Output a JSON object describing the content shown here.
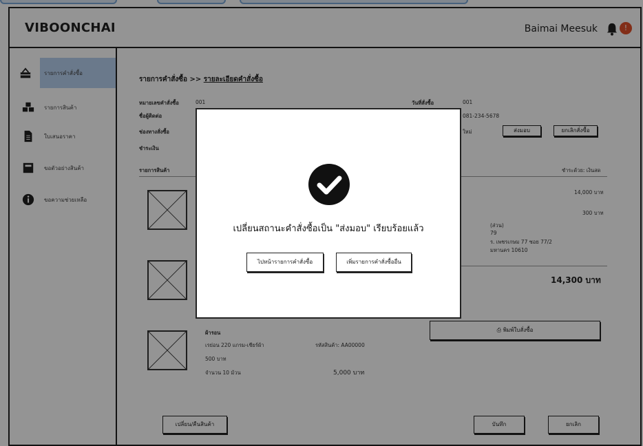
{
  "header": {
    "logo": "VIBOONCHAI",
    "user_name": "Baimai Meesuk",
    "notification_count": "!"
  },
  "sidebar": {
    "items": [
      {
        "label": "รายการคำสั่งซื้อ",
        "icon": "basket-icon",
        "active": true
      },
      {
        "label": "รายการสินค้า",
        "icon": "boxes-icon",
        "active": false
      },
      {
        "label": "ใบเสนอราคา",
        "icon": "document-icon",
        "active": false
      },
      {
        "label": "ขอตัวอย่างสินค้า",
        "icon": "sample-box-icon",
        "active": false
      },
      {
        "label": "ขอความช่วยเหลือ",
        "icon": "info-icon",
        "active": false
      }
    ]
  },
  "main": {
    "breadcrumb_root": "รายการคำสั่งซื้อ >> ",
    "breadcrumb_current": "รายละเอียดคำสั่งซื้อ",
    "order_no_label": "หมายเลขคำสั่งซื้อ",
    "order_no_value": "001",
    "customer_label": "ชื่อผู้ติดต่อ",
    "channel_label": "ช่องทางสั่งซื้อ",
    "payment_label": "ชำระเงิน",
    "order_date_label": "วันที่สั่งซื้อ",
    "order_date_value": "001",
    "phone_value": "081-234-5678",
    "status_suffix": "ใหม่",
    "deliver_button": "ส่งมอบ",
    "cancel_order_button": "ยกเลิกสั่งซื้อ",
    "items_header": "รายการสินค้า",
    "right_header": "ชำระด้วย: เงินสด",
    "amount_1": "14,000 บาท",
    "amount_2": "300 บาท",
    "addr_1": "(ส่วน)",
    "addr_2": "79",
    "addr_3": "ร. เพชรเกษม 77 ซอย 77/2",
    "addr_4": "มหานคร 10610",
    "grand_total": "14,300 บาท",
    "print_button": "พิมพ์ใบสั่งซื้อ",
    "item3_name": "ผ้ารอน",
    "item3_spec": "เรย่อน 220 แกรม-เชียร์ผ้า",
    "item3_code": "รหัสสินค้า: AA00000",
    "item3_price": "500 บาท",
    "item3_qty": "จำนวน 10 ม้วน",
    "item3_total": "5,000 บาท",
    "exchange_button": "เปลี่ยน/คืนสินค้า",
    "save_button": "บันทึก",
    "cancel_button": "ยกเลิก"
  },
  "modal": {
    "message": "เปลี่ยนสถานะคำสั่งซื้อเป็น \"ส่งมอบ\" เรียบร้อยแล้ว",
    "go_orders_button": "ไปหน้ารายการคำสั่งซื้อ",
    "add_order_button": "เพิ่มรายการคำสั่งซื้ออื่น"
  },
  "colors": {
    "sidebar_active": "#b7d0ef",
    "badge": "#e0502a",
    "overlay": "rgba(0,0,0,0.42)"
  }
}
